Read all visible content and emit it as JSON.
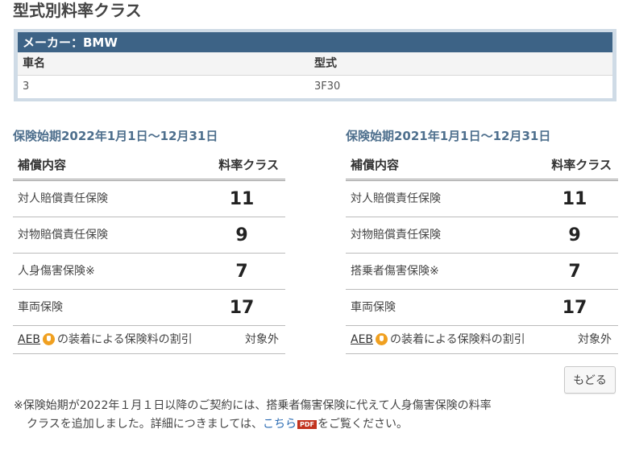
{
  "page_title": "型式別料率クラス",
  "vehicle": {
    "maker_label": "メーカー：BMW",
    "col_name": "車名",
    "col_model": "型式",
    "name_value": "3",
    "model_value": "3F30"
  },
  "periods": [
    {
      "title": "保険始期2022年1月1日〜12月31日",
      "col_coverage": "補償内容",
      "col_class": "料率クラス",
      "rows": [
        {
          "coverage": "対人賠償責任保険",
          "class": "11"
        },
        {
          "coverage": "対物賠償責任保険",
          "class": "9"
        },
        {
          "coverage": "人身傷害保険※",
          "class": "7"
        },
        {
          "coverage": "車両保険",
          "class": "17"
        }
      ],
      "aeb": {
        "link": "AEB",
        "text": "の装着による保険料の割引",
        "value": "対象外"
      }
    },
    {
      "title": "保険始期2021年1月1日〜12月31日",
      "col_coverage": "補償内容",
      "col_class": "料率クラス",
      "rows": [
        {
          "coverage": "対人賠償責任保険",
          "class": "11"
        },
        {
          "coverage": "対物賠償責任保険",
          "class": "9"
        },
        {
          "coverage": "搭乗者傷害保険※",
          "class": "7"
        },
        {
          "coverage": "車両保険",
          "class": "17"
        }
      ],
      "aeb": {
        "link": "AEB",
        "text": "の装着による保険料の割引",
        "value": "対象外"
      }
    }
  ],
  "back_button": "もどる",
  "note": {
    "line1": "※保険始期が2022年１月１日以降のご契約には、搭乗者傷害保険に代えて人身傷害保険の料率",
    "line2_before": "クラスを追加しました。詳細につきましては、",
    "link": "こちら",
    "pdf_badge": "PDF",
    "line2_after": "をご覧ください。"
  },
  "colors": {
    "header_bar": "#3d6386",
    "period_title": "#4e6f8d",
    "link": "#2b6bb3",
    "pdf_badge": "#c2331e"
  }
}
